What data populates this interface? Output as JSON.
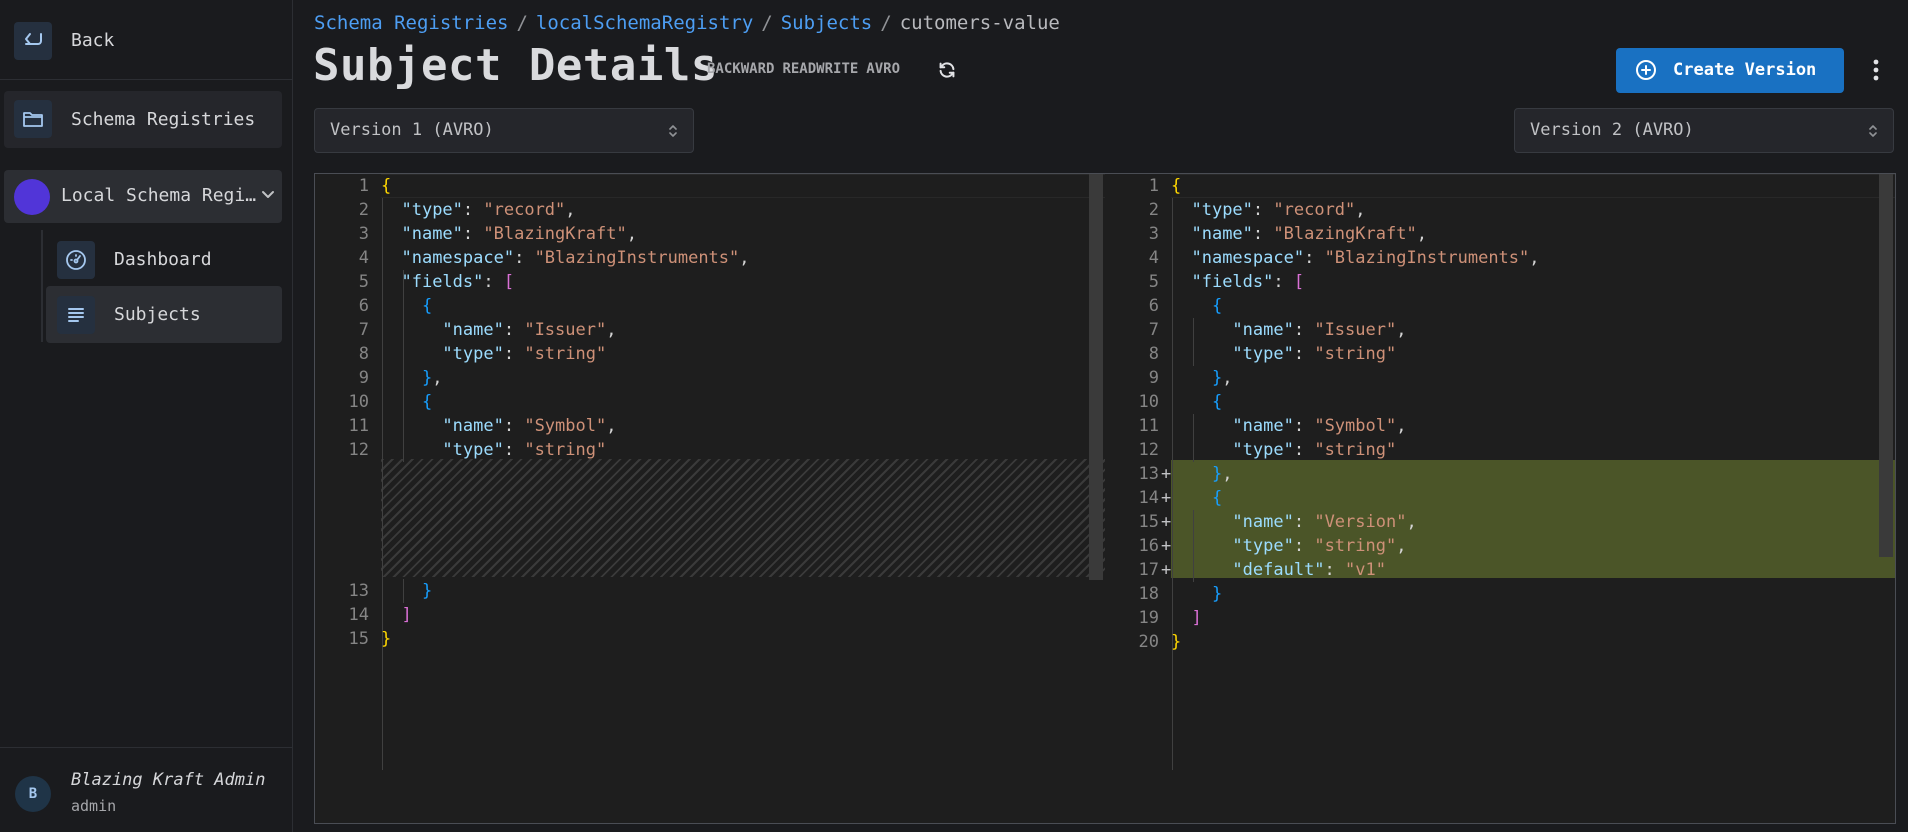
{
  "sidebar": {
    "back_label": "Back",
    "schema_registries_label": "Schema Registries",
    "registry_label": "Local Schema Registry",
    "dashboard_label": "Dashboard",
    "subjects_label": "Subjects",
    "user": {
      "initial": "B",
      "name": "Blazing Kraft Admin",
      "role": "admin"
    }
  },
  "breadcrumb": {
    "items": [
      "Schema Registries",
      "localSchemaRegistry",
      "Subjects"
    ],
    "separator": "/",
    "current": "cutomers-value"
  },
  "header": {
    "title": "Subject Details",
    "badges": [
      "BACKWARD",
      "READWRITE",
      "AVRO"
    ],
    "create_version_label": "Create Version"
  },
  "versions": {
    "left_selected": "Version 1 (AVRO)",
    "right_selected": "Version 2 (AVRO)"
  },
  "diff": {
    "left_line_numbers": [
      "1",
      "2",
      "3",
      "4",
      "5",
      "6",
      "7",
      "8",
      "9",
      "10",
      "11",
      "12",
      "13",
      "14",
      "15"
    ],
    "right_line_numbers": [
      "1",
      "2",
      "3",
      "4",
      "5",
      "6",
      "7",
      "8",
      "9",
      "10",
      "11",
      "12",
      "13",
      "14",
      "15",
      "16",
      "17",
      "18",
      "19",
      "20"
    ],
    "added_marker": "+",
    "added_lines": [
      13,
      14,
      15,
      16,
      17
    ],
    "added_color": "#4b5528",
    "tokens": {
      "open_brace": "{",
      "close_brace": "}",
      "open_bracket": "[",
      "close_bracket": "]",
      "type_key": "\"type\"",
      "record": "\"record\"",
      "name_key": "\"name\"",
      "blazingkraft": "\"BlazingKraft\"",
      "namespace_key": "\"namespace\"",
      "blazinginstruments": "\"BlazingInstruments\"",
      "fields_key": "\"fields\"",
      "issuer": "\"Issuer\"",
      "string": "\"string\"",
      "symbol": "\"Symbol\"",
      "version": "\"Version\"",
      "default_key": "\"default\"",
      "v1": "\"v1\""
    }
  },
  "colors": {
    "accent": "#1971c2",
    "link": "#4d9ef3",
    "registry_avatar": "#5135d8"
  },
  "icons": {
    "back": "enter-arrow-icon",
    "schema_registries": "folder-icon",
    "registry_toggle": "chevron-down-icon",
    "dashboard": "gauge-icon",
    "subjects": "list-icon",
    "refresh": "refresh-icon",
    "create": "plus-circle-icon",
    "menu": "dots-vertical-icon",
    "select": "selector-icon"
  }
}
